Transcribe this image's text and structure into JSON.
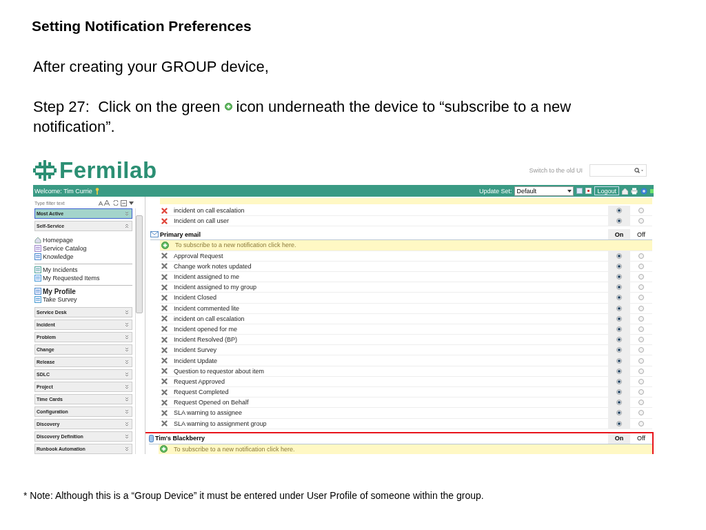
{
  "slide": {
    "title": "Setting Notification Preferences",
    "intro": "After creating your GROUP device,",
    "step_before": "Step 27:  Click on the green",
    "step_after": "icon underneath the device to “subscribe to a new",
    "step_end": "notification”.",
    "note": "* Note: Although this is a “Group Device” it must be entered under User Profile of someone within the group."
  },
  "app": {
    "logo": "Fermilab",
    "switch_link": "Switch to the old UI",
    "welcome": "Welcome: Tim Currie",
    "update_set_label": "Update Set:",
    "update_set": "Default",
    "logout": "Logout",
    "sidebar": {
      "filter_placeholder": "Type filter text",
      "sections": [
        {
          "label": "Most Active",
          "expanded": false,
          "selected": true
        },
        {
          "label": "Self-Service",
          "expanded": true,
          "selected": false,
          "groups": [
            [
              {
                "label": "Homepage",
                "selected": false
              },
              {
                "label": "Service Catalog",
                "selected": false
              },
              {
                "label": "Knowledge",
                "selected": false
              }
            ],
            [
              {
                "label": "My Incidents",
                "selected": false
              },
              {
                "label": "My Requested Items",
                "selected": false
              }
            ],
            [
              {
                "label": "My Profile",
                "selected": true
              },
              {
                "label": "Take Survey",
                "selected": false
              }
            ]
          ]
        },
        {
          "label": "Service Desk",
          "expanded": false,
          "selected": false
        },
        {
          "label": "Incident",
          "expanded": false,
          "selected": false
        },
        {
          "label": "Problem",
          "expanded": false,
          "selected": false
        },
        {
          "label": "Change",
          "expanded": false,
          "selected": false
        },
        {
          "label": "Release",
          "expanded": false,
          "selected": false
        },
        {
          "label": "SDLC",
          "expanded": false,
          "selected": false
        },
        {
          "label": "Project",
          "expanded": false,
          "selected": false
        },
        {
          "label": "Time Cards",
          "expanded": false,
          "selected": false
        },
        {
          "label": "Configuration",
          "expanded": false,
          "selected": false
        },
        {
          "label": "Discovery",
          "expanded": false,
          "selected": false
        },
        {
          "label": "Discovery Definition",
          "expanded": false,
          "selected": false
        },
        {
          "label": "Runbook Automation",
          "expanded": false,
          "selected": false
        }
      ]
    },
    "devices": [
      {
        "kind": "clipped",
        "highlighted": false,
        "rows": [
          {
            "label": "incident on call escalation",
            "kind": "removable",
            "on": true
          },
          {
            "label": "Incident on call user",
            "kind": "removable",
            "on": true
          }
        ]
      },
      {
        "kind": "email",
        "title": "Primary email",
        "on_label": "On",
        "off_label": "Off",
        "highlighted": false,
        "subscribe": "To subscribe to a new notification click here.",
        "rows": [
          {
            "label": "Approval Request",
            "kind": "fixed",
            "on": true
          },
          {
            "label": "Change work notes updated",
            "kind": "fixed",
            "on": true
          },
          {
            "label": "Incident assigned to me",
            "kind": "fixed",
            "on": true
          },
          {
            "label": "Incident assigned to my group",
            "kind": "fixed",
            "on": true
          },
          {
            "label": "Incident Closed",
            "kind": "fixed",
            "on": true
          },
          {
            "label": "Incident commented lite",
            "kind": "fixed",
            "on": true
          },
          {
            "label": "incident on call escalation",
            "kind": "fixed",
            "on": true
          },
          {
            "label": "Incident opened for me",
            "kind": "fixed",
            "on": true
          },
          {
            "label": "Incident Resolved (BP)",
            "kind": "fixed",
            "on": true
          },
          {
            "label": "Incident Survey",
            "kind": "fixed",
            "on": true
          },
          {
            "label": "Incident Update",
            "kind": "fixed",
            "on": true
          },
          {
            "label": "Question to requestor about item",
            "kind": "fixed",
            "on": true
          },
          {
            "label": "Request Approved",
            "kind": "fixed",
            "on": true
          },
          {
            "label": "Request Completed",
            "kind": "fixed",
            "on": true
          },
          {
            "label": "Request Opened on Behalf",
            "kind": "fixed",
            "on": true
          },
          {
            "label": "SLA warning to assignee",
            "kind": "fixed",
            "on": true
          },
          {
            "label": "SLA warning to assignment group",
            "kind": "fixed",
            "on": true
          }
        ]
      },
      {
        "kind": "phone",
        "title": "Tim's Blackberry",
        "on_label": "On",
        "off_label": "Off",
        "highlighted": true,
        "subscribe": "To subscribe to a new notification click here."
      }
    ]
  }
}
